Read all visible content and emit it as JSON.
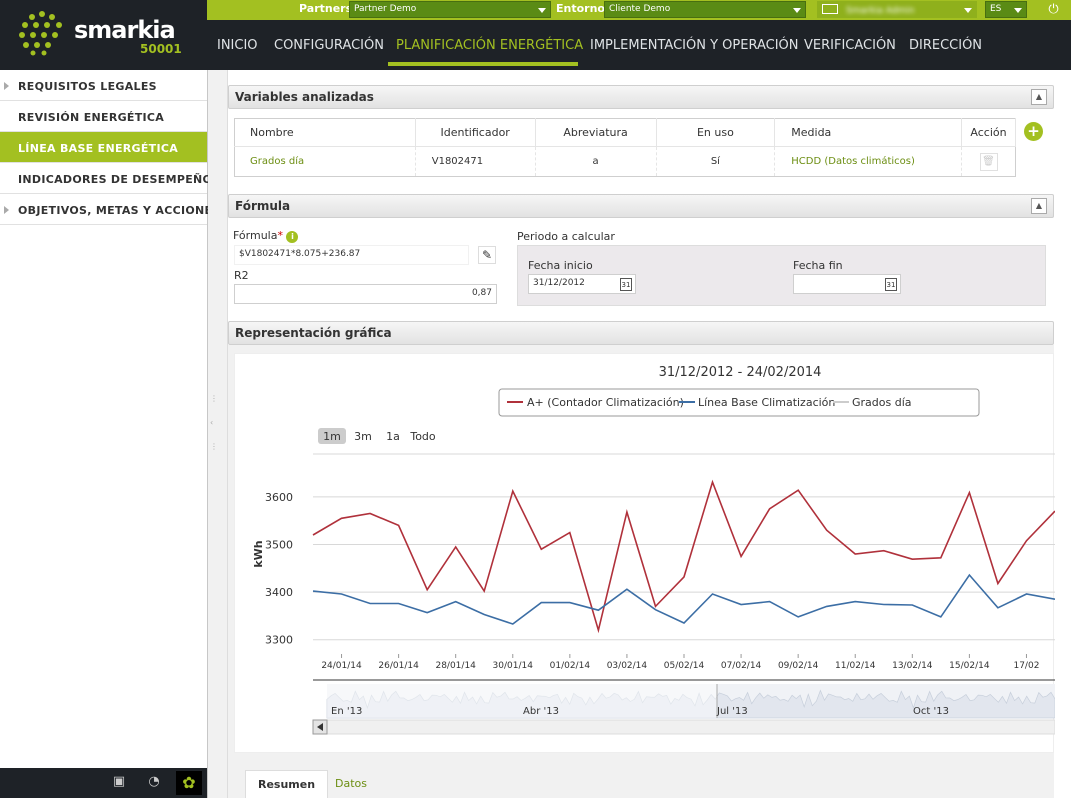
{
  "header": {
    "logo_name": "smarkia",
    "logo_sub": "50001",
    "partners_label": "Partners",
    "partners_value": "Partner Demo",
    "entorno_label": "Entorno",
    "entorno_value": "Cliente Demo",
    "user_value": "Smarkia Admin",
    "lang_value": "ES",
    "nav": [
      {
        "label": "INICIO"
      },
      {
        "label": "CONFIGURACIÓN"
      },
      {
        "label": "PLANIFICACIÓN ENERGÉTICA"
      },
      {
        "label": "IMPLEMENTACIÓN Y OPERACIÓN"
      },
      {
        "label": "VERIFICACIÓN"
      },
      {
        "label": "DIRECCIÓN"
      }
    ],
    "accent": "#a3c021"
  },
  "sidebar": {
    "items": [
      {
        "label": "REQUISITOS LEGALES"
      },
      {
        "label": "REVISIÓN ENERGÉTICA"
      },
      {
        "label": "LÍNEA BASE ENERGÉTICA"
      },
      {
        "label": "INDICADORES DE DESEMPEÑO"
      },
      {
        "label": "OBJETIVOS, METAS Y ACCIONES"
      }
    ]
  },
  "variables": {
    "title": "Variables analizadas",
    "columns": [
      "Nombre",
      "Identificador",
      "Abreviatura",
      "En uso",
      "Medida",
      "Acción"
    ],
    "rows": [
      {
        "nombre": "Grados día",
        "identificador": "V1802471",
        "abreviatura": "a",
        "en_uso": "Sí",
        "medida": "HCDD (Datos climáticos)"
      }
    ]
  },
  "formula": {
    "title": "Fórmula",
    "formula_label": "Fórmula",
    "formula_required": "*",
    "formula_value": "$V1802471*8.075+236.87",
    "r2_label": "R2",
    "r2_value": "0,87",
    "periodo_label": "Periodo a calcular",
    "fecha_inicio_label": "Fecha inicio",
    "fecha_inicio_value": "31/12/2012",
    "fecha_fin_label": "Fecha fin",
    "fecha_fin_value": ""
  },
  "grafica": {
    "title": "Representación gráfica",
    "range_buttons": [
      "1m",
      "3m",
      "1a",
      "Todo"
    ],
    "navigator_labels": [
      "En '13",
      "Abr '13",
      "Jul '13",
      "Oct '13"
    ]
  },
  "bottom_tabs": [
    "Resumen",
    "Datos"
  ],
  "chart_data": {
    "type": "line",
    "title": "31/12/2012 - 24/02/2014",
    "ylabel": "kWh",
    "ylim": [
      3270,
      3690
    ],
    "yticks": [
      3300,
      3400,
      3500,
      3600
    ],
    "xticks": [
      "24/01/14",
      "26/01/14",
      "28/01/14",
      "30/01/14",
      "01/02/14",
      "03/02/14",
      "05/02/14",
      "07/02/14",
      "09/02/14",
      "11/02/14",
      "13/02/14",
      "15/02/14",
      "17/02"
    ],
    "x": [
      "23/01/14",
      "24/01/14",
      "25/01/14",
      "26/01/14",
      "27/01/14",
      "28/01/14",
      "29/01/14",
      "30/01/14",
      "31/01/14",
      "01/02/14",
      "02/02/14",
      "03/02/14",
      "04/02/14",
      "05/02/14",
      "06/02/14",
      "07/02/14",
      "08/02/14",
      "09/02/14",
      "10/02/14",
      "11/02/14",
      "12/02/14",
      "13/02/14",
      "14/02/14",
      "15/02/14",
      "16/02/14",
      "17/02/14",
      "18/02/14"
    ],
    "series": [
      {
        "name": "A+ (Contador Climatización)",
        "color": "#b0313b",
        "values": [
          3520,
          3555,
          3565,
          3540,
          3405,
          3495,
          3402,
          3612,
          3490,
          3525,
          3320,
          3568,
          3370,
          3432,
          3631,
          3475,
          3575,
          3614,
          3530,
          3480,
          3487,
          3469,
          3472,
          3609,
          3418,
          3508,
          3570
        ]
      },
      {
        "name": "Línea Base Climatización",
        "color": "#3c6ea5",
        "values": [
          3402,
          3396,
          3376,
          3376,
          3357,
          3380,
          3353,
          3333,
          3378,
          3378,
          3362,
          3406,
          3363,
          3335,
          3396,
          3374,
          3380,
          3348,
          3370,
          3380,
          3374,
          3373,
          3348,
          3436,
          3367,
          3396,
          3385
        ]
      },
      {
        "name": "Grados día",
        "color": "#cccccc",
        "values": []
      }
    ],
    "legend": "top",
    "grid": true
  }
}
